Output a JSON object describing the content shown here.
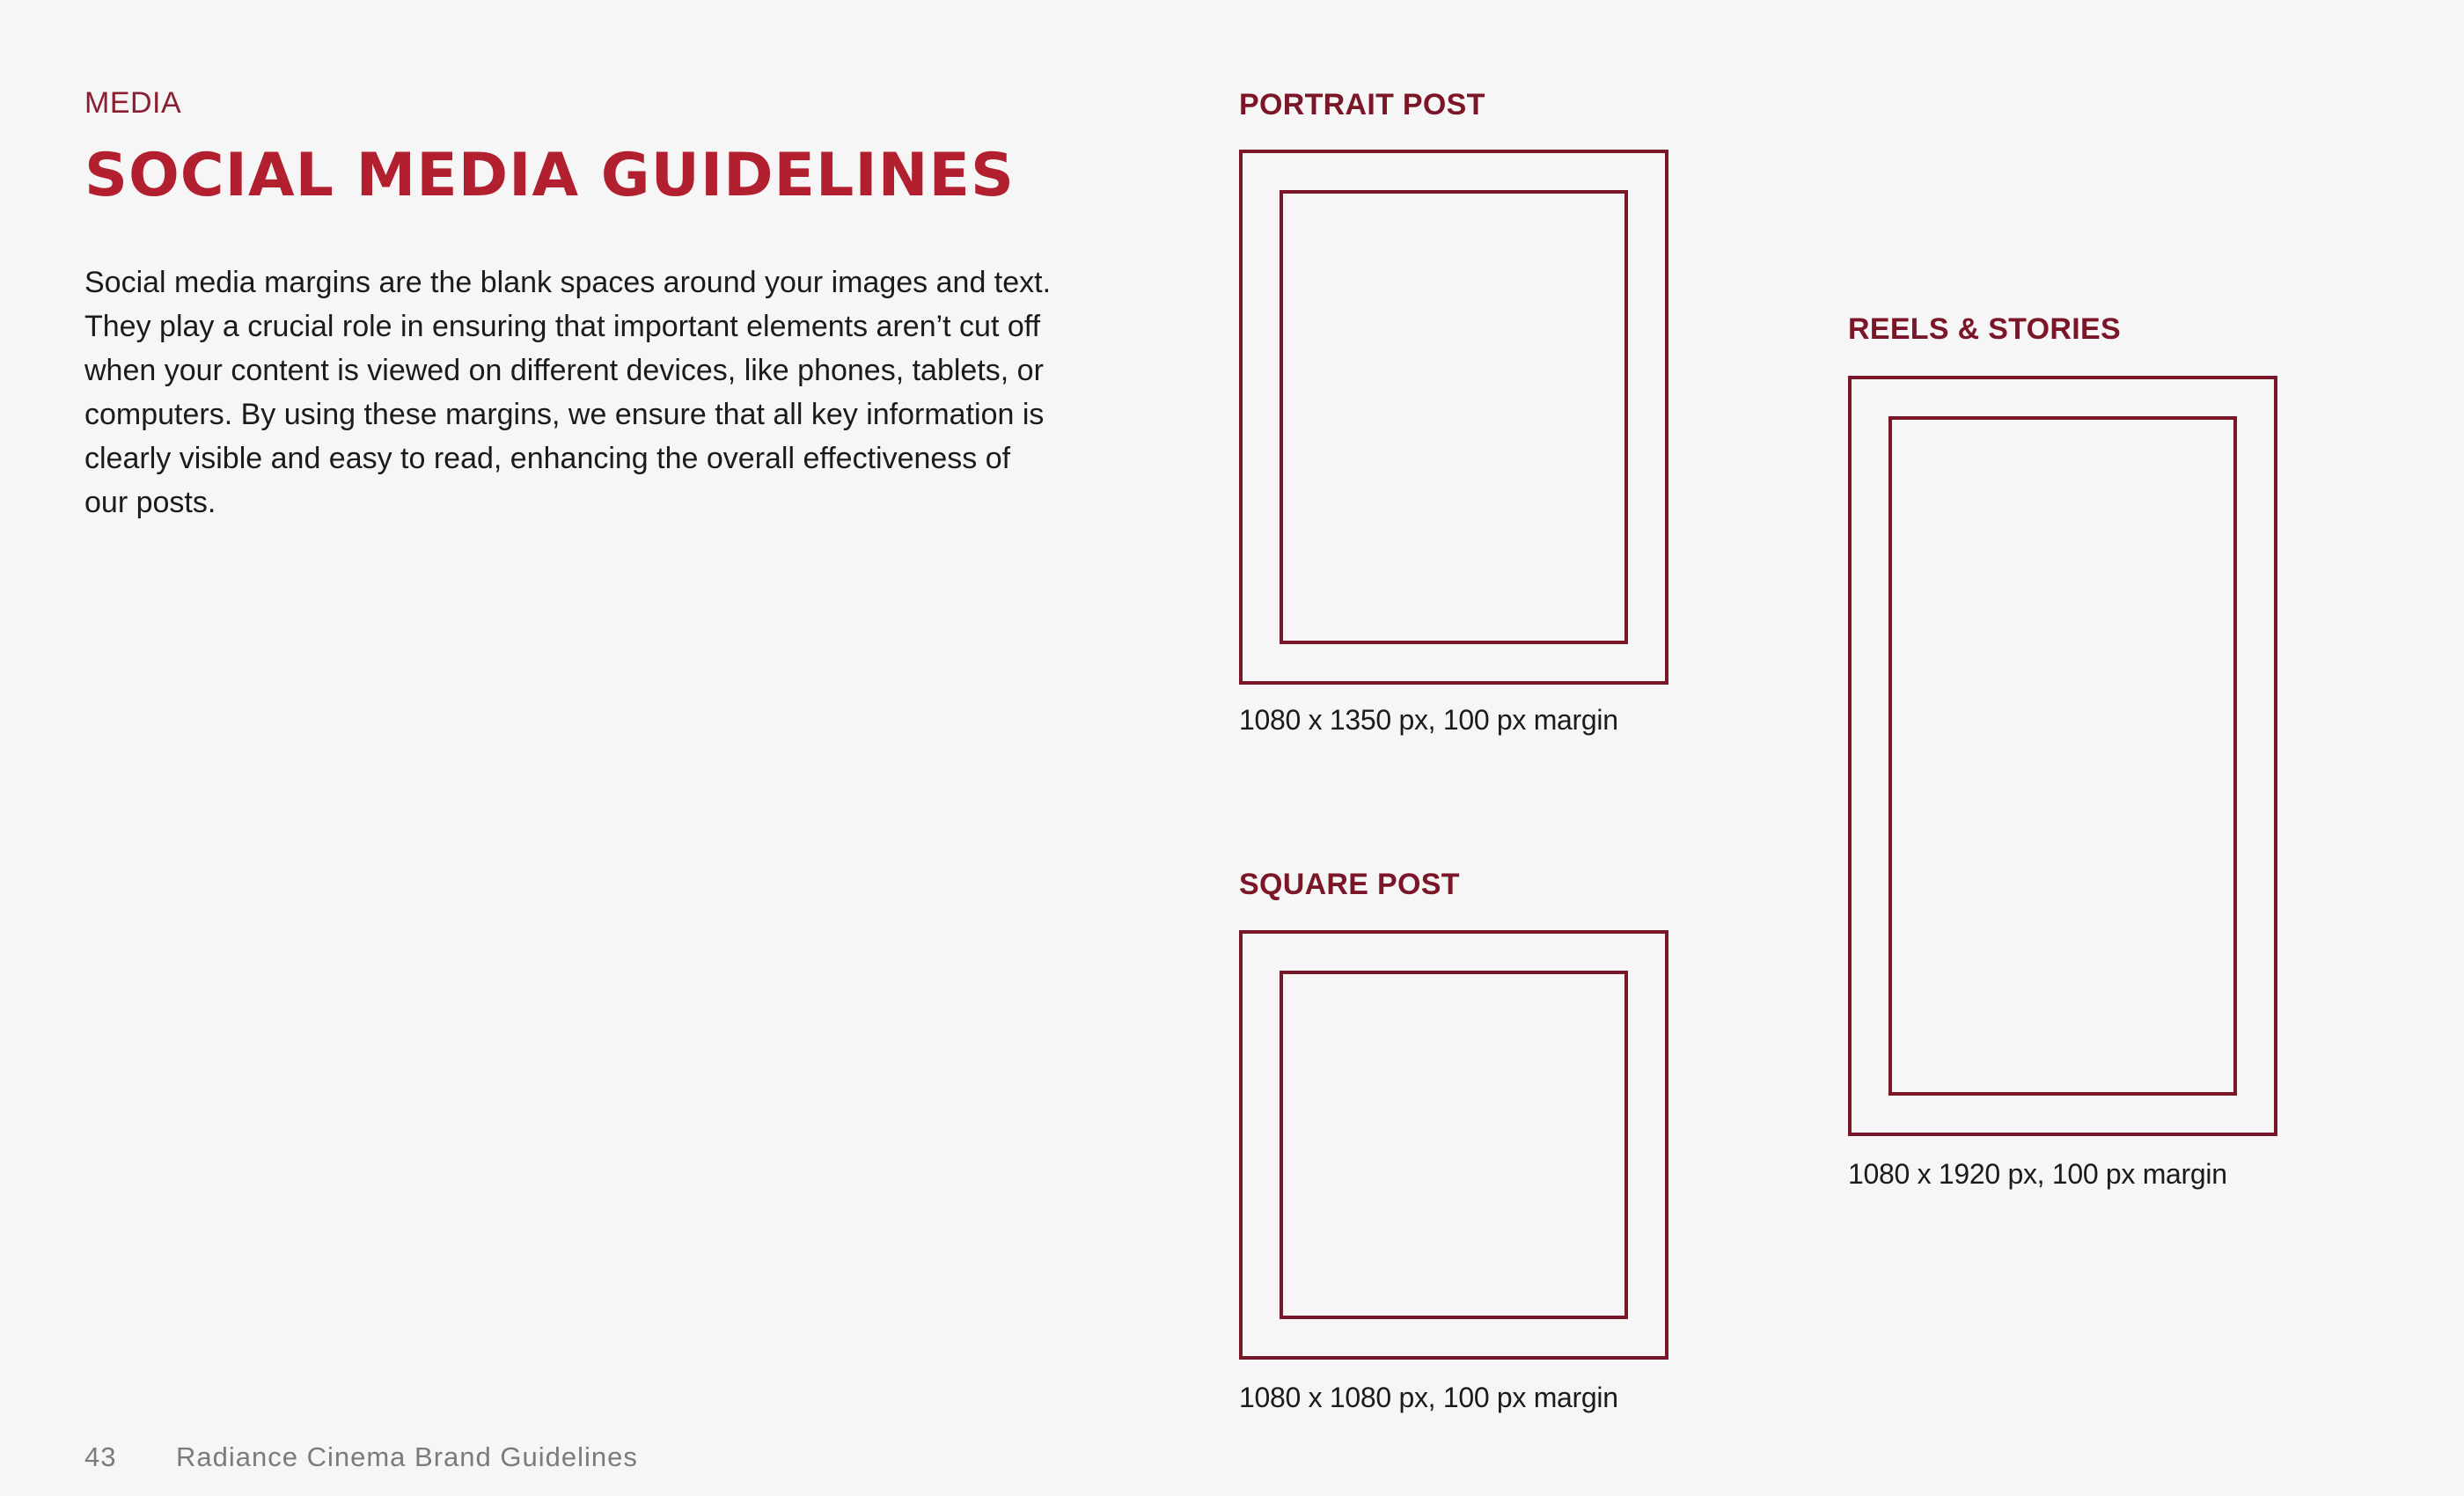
{
  "header": {
    "eyebrow": "MEDIA",
    "title": "SOCIAL MEDIA GUIDELINES"
  },
  "intro": "Social media margins are the blank spaces around your images and text. They play a crucial role in ensuring that important elements aren’t cut off when your content is viewed on different devices, like phones, tablets, or computers. By using these margins, we ensure that all key information is clearly visible and easy to read, enhancing the overall effectiveness of our posts.",
  "formats": {
    "portrait": {
      "label": "PORTRAIT POST",
      "caption": "1080 x 1350 px, 100 px margin"
    },
    "square": {
      "label": "SQUARE POST",
      "caption": "1080 x 1080 px, 100 px margin"
    },
    "reels": {
      "label": "REELS & STORIES",
      "caption": "1080 x 1920 px, 100 px margin"
    }
  },
  "footer": {
    "page_number": "43",
    "document_title": "Radiance Cinema Brand Guidelines"
  },
  "colors": {
    "heading": "#b2202f",
    "accent": "#7a1628",
    "background": "#f6f6f6"
  }
}
